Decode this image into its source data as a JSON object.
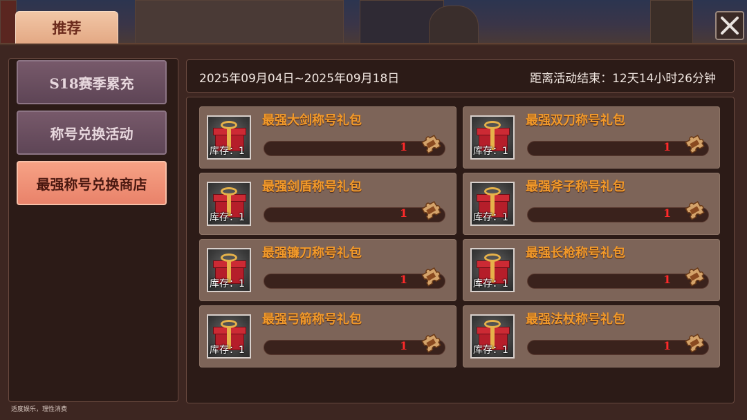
{
  "header": {
    "tab_label": "推荐"
  },
  "sidebar": {
    "items": [
      {
        "label": "S18赛季累充",
        "active": false
      },
      {
        "label": "称号兑换活动",
        "active": false
      },
      {
        "label": "最强称号兑换商店",
        "active": true
      }
    ]
  },
  "event": {
    "date_range": "2025年09月04日~2025年09月18日",
    "countdown": "距离活动结束：12天14小时26分钟"
  },
  "items": [
    {
      "name": "最强大剑称号礼包",
      "stock": "库存：1",
      "count": "1",
      "progress": 0.0
    },
    {
      "name": "最强双刀称号礼包",
      "stock": "库存：1",
      "count": "1",
      "progress": 0.0
    },
    {
      "name": "最强剑盾称号礼包",
      "stock": "库存：1",
      "count": "1",
      "progress": 0.0
    },
    {
      "name": "最强斧子称号礼包",
      "stock": "库存：1",
      "count": "1",
      "progress": 0.0
    },
    {
      "name": "最强镰刀称号礼包",
      "stock": "库存：1",
      "count": "1",
      "progress": 0.0
    },
    {
      "name": "最强长枪称号礼包",
      "stock": "库存：1",
      "count": "1",
      "progress": 0.0
    },
    {
      "name": "最强弓箭称号礼包",
      "stock": "库存：1",
      "count": "1",
      "progress": 0.0
    },
    {
      "name": "最强法杖称号礼包",
      "stock": "库存：1",
      "count": "1",
      "progress": 0.0
    }
  ],
  "footer": {
    "notice": "适度娱乐，理性消费"
  },
  "colors": {
    "item_name": "#f39a2a",
    "active_tab": "#e9826a",
    "count_text": "#ff2a2a"
  },
  "icons": {
    "close": "close-icon",
    "gift": "gift-box-icon",
    "badge": "strongest-puzzle-badge-icon"
  }
}
